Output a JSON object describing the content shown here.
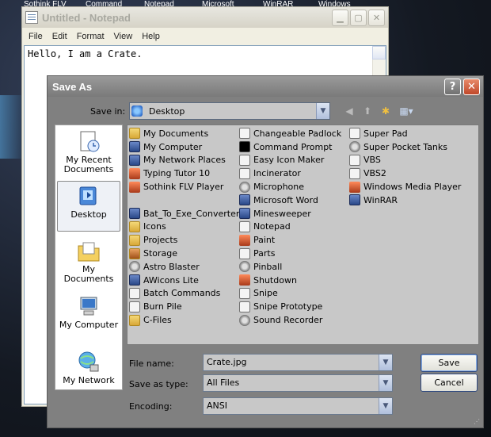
{
  "desktop": {
    "labels": [
      "Sothink FLV",
      "Command",
      "Notepad",
      "Microsoft",
      "WinRAR",
      "Windows"
    ]
  },
  "notepad": {
    "title": "Untitled - Notepad",
    "menu": [
      "File",
      "Edit",
      "Format",
      "View",
      "Help"
    ],
    "content": "Hello, I am a Crate."
  },
  "dialog": {
    "title": "Save As",
    "help": "?",
    "close": "✕",
    "save_in_label": "Save in:",
    "save_in_value": "Desktop",
    "places": [
      {
        "label": "My Recent Documents",
        "icon": "recent-documents-icon"
      },
      {
        "label": "Desktop",
        "icon": "desktop-icon"
      },
      {
        "label": "My Documents",
        "icon": "my-documents-icon"
      },
      {
        "label": "My Computer",
        "icon": "my-computer-icon"
      },
      {
        "label": "My Network",
        "icon": "my-network-icon"
      }
    ],
    "files": {
      "col1": [
        "My Documents",
        "My Computer",
        "My Network Places",
        "Typing Tutor 10",
        "Sothink FLV Player",
        "",
        "Bat_To_Exe_Converter",
        "Icons",
        "Projects",
        "Storage",
        "Astro Blaster",
        "AWicons Lite",
        "Batch Commands",
        "Burn Pile",
        "C-Files"
      ],
      "col2": [
        "Changeable Padlock",
        "Command Prompt",
        "Easy Icon Maker",
        "Incinerator",
        "Microphone",
        "Microsoft Word",
        "Minesweeper",
        "Notepad",
        "Paint",
        "Parts",
        "Pinball",
        "Shutdown",
        "Snipe",
        "Snipe Prototype",
        "Sound Recorder"
      ],
      "col3": [
        "Super Pad",
        "Super Pocket Tanks",
        "VBS",
        "VBS2",
        "Windows Media Player",
        "WinRAR"
      ]
    },
    "file_name_label": "File name:",
    "file_name_value": "Crate.jpg",
    "save_as_type_label": "Save as type:",
    "save_as_type_value": "All Files",
    "encoding_label": "Encoding:",
    "encoding_value": "ANSI",
    "save_button": "Save",
    "cancel_button": "Cancel"
  }
}
